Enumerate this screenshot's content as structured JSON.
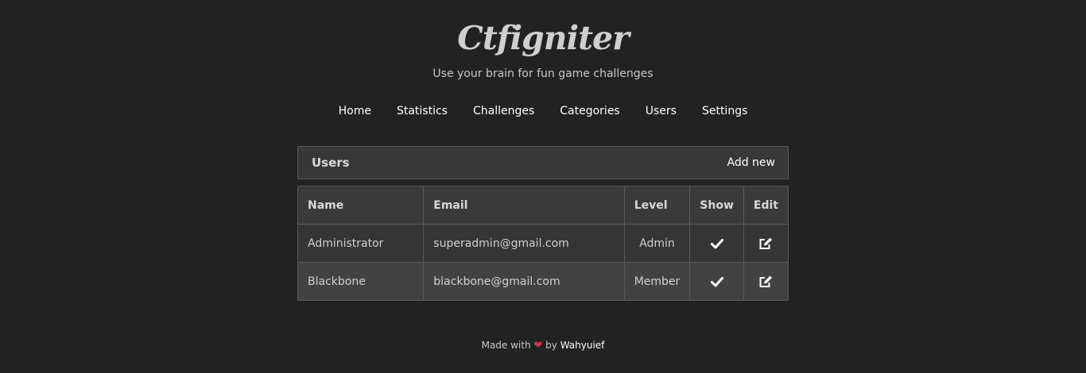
{
  "brand": {
    "title": "Ctfigniter",
    "tagline": "Use your brain for fun game challenges"
  },
  "nav": {
    "items": [
      {
        "label": "Home"
      },
      {
        "label": "Statistics"
      },
      {
        "label": "Challenges"
      },
      {
        "label": "Categories"
      },
      {
        "label": "Users"
      },
      {
        "label": "Settings"
      }
    ]
  },
  "panel": {
    "title": "Users",
    "add_label": "Add new"
  },
  "table": {
    "columns": [
      "Name",
      "Email",
      "Level",
      "Show",
      "Edit"
    ],
    "rows": [
      {
        "name": "Administrator",
        "email": "superadmin@gmail.com",
        "level": "Admin"
      },
      {
        "name": "Blackbone",
        "email": "blackbone@gmail.com",
        "level": "Member"
      }
    ]
  },
  "icons": {
    "show": "checkmark-icon",
    "edit": "edit-icon",
    "footer": "heart-icon"
  },
  "footer": {
    "prefix": "Made with",
    "by": "by",
    "author": "Wahyuief"
  },
  "colors": {
    "background": "#222222",
    "panel": "#383838",
    "heart": "#d9334a"
  }
}
